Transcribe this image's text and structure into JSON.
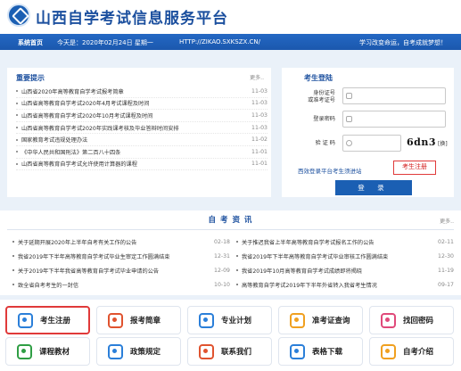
{
  "header": {
    "site_title": "山西自学考试信息服务平台"
  },
  "navbar": {
    "home": "系统首页",
    "date": "今天是：2020年02月24日",
    "weekday": "星期一",
    "url": "HTTP://ZIKAO.SXKSZX.CN/",
    "motto": "学习改变命运，自考成就梦想！"
  },
  "notice": {
    "title": "重要提示",
    "more": "更多..",
    "items": [
      {
        "title": "山西省2020年高等教育自学考试报考简章",
        "date": "11-03"
      },
      {
        "title": "山西省高等教育自学考试2020年4月考试课程及时间",
        "date": "11-03"
      },
      {
        "title": "山西省高等教育自学考试2020年10月考试课程及时间",
        "date": "11-03"
      },
      {
        "title": "山西省高等教育自学考试2020年实践课考核及毕业答辩时间安排",
        "date": "11-03"
      },
      {
        "title": "国家教育考试违规处理办法",
        "date": "11-02"
      },
      {
        "title": "《中华人民共和国刑法》第二百八十四条",
        "date": "11-01"
      },
      {
        "title": "山西省高等教育自学考试允许使用计算器的课程",
        "date": "11-01"
      }
    ]
  },
  "login": {
    "title": "考生登陆",
    "id_label": "身份证号\n或准考证号",
    "password_label": "登录密码",
    "captcha_label": "验 证 码",
    "captcha_text": "6dn3",
    "refresh": "[换]",
    "exam_login_link": "西效登录平台考生须进站",
    "register_link": "考生注册",
    "login_button": "登 录"
  },
  "news": {
    "title": "自 考 资 讯",
    "more": "更多..",
    "left": [
      {
        "title": "关于延期开展2020年上半年自考有关工作的公告",
        "date": "02-18"
      },
      {
        "title": "我省2019年下半年高等教育自学考试毕业生审定工作圆满结束",
        "date": "12-31"
      },
      {
        "title": "关于2019年下半年我省高等教育自学考试毕业申请的公告",
        "date": "12-09"
      },
      {
        "title": "致全省自考考生的一封信",
        "date": "10-10"
      }
    ],
    "right": [
      {
        "title": "关于推迟我省上半年高等教育自学考试报名工作的公告",
        "date": "02-11"
      },
      {
        "title": "我省2019年下半年高等教育自学考试毕业审核工作圆满结束",
        "date": "12-30"
      },
      {
        "title": "我省2019年10月高等教育自学考试成绩即将揭晓",
        "date": "11-19"
      },
      {
        "title": "高等教育自学考试2019年下半年外省转入我省考生情况",
        "date": "09-17"
      }
    ]
  },
  "quick": {
    "items": [
      {
        "label": "考生注册",
        "icon": "user-icon",
        "color": "#2b7fd9"
      },
      {
        "label": "报考简章",
        "icon": "brochure-icon",
        "color": "#e0532f"
      },
      {
        "label": "专业计划",
        "icon": "plan-icon",
        "color": "#2b7fd9"
      },
      {
        "label": "准考证查询",
        "icon": "admission-icon",
        "color": "#f0a020"
      },
      {
        "label": "找回密码",
        "icon": "key-icon",
        "color": "#e04a7a"
      },
      {
        "label": "课程教材",
        "icon": "book-icon",
        "color": "#2f9e44"
      },
      {
        "label": "政策规定",
        "icon": "policy-icon",
        "color": "#2b7fd9"
      },
      {
        "label": "联系我们",
        "icon": "phone-icon",
        "color": "#e0532f"
      },
      {
        "label": "表格下载",
        "icon": "table-icon",
        "color": "#2b7fd9"
      },
      {
        "label": "自考介绍",
        "icon": "intro-icon",
        "color": "#f0a020"
      }
    ]
  }
}
